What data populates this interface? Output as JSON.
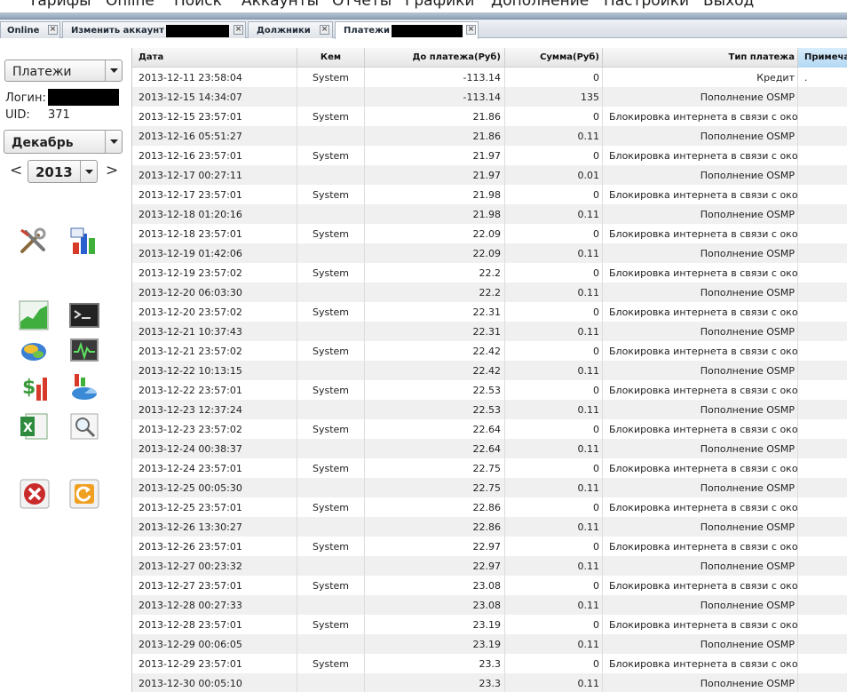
{
  "menu": {
    "items": [
      "Тарифы",
      "Online",
      "Поиск",
      "Аккаунты",
      "Отчеты",
      "Графики",
      "Дополнение",
      "Настройки",
      "Выход"
    ]
  },
  "tabs": [
    {
      "label": "Online",
      "active": false
    },
    {
      "label": "Изменить аккаунт",
      "active": false
    },
    {
      "label": "Должники",
      "active": false
    },
    {
      "label": "Платежи",
      "active": true
    }
  ],
  "left": {
    "report_select": "Платежи",
    "login_label": "Логин:",
    "uid_label": "UID:",
    "uid_value": "371",
    "month_select": "Декабрь",
    "year_select": "2013",
    "prev": "<",
    "next": ">",
    "tools": [
      "tools-icon",
      "bar-chart-icon",
      "line-chart-icon",
      "terminal-icon",
      "network-icon",
      "monitor-icon",
      "money-chart-icon",
      "pie-chart-icon",
      "excel-icon",
      "search-icon"
    ],
    "actions": [
      "close-icon",
      "refresh-icon"
    ]
  },
  "table": {
    "columns": [
      "Дата",
      "Кем",
      "До платежа(Руб)",
      "Сумма(Руб)",
      "Тип платежа",
      "Примеча"
    ],
    "rows": [
      [
        "2013-12-11 23:58:04",
        "System",
        "-113.14",
        "0",
        "Кредит",
        "."
      ],
      [
        "2013-12-15 14:34:07",
        "",
        "-113.14",
        "135",
        "Пополнение OSMP",
        ""
      ],
      [
        "2013-12-15 23:57:01",
        "System",
        "21.86",
        "0",
        "Блокировка интернета в связи с оконча",
        ""
      ],
      [
        "2013-12-16 05:51:27",
        "",
        "21.86",
        "0.11",
        "Пополнение OSMP",
        ""
      ],
      [
        "2013-12-16 23:57:01",
        "System",
        "21.97",
        "0",
        "Блокировка интернета в связи с оконча",
        ""
      ],
      [
        "2013-12-17 00:27:11",
        "",
        "21.97",
        "0.01",
        "Пополнение OSMP",
        ""
      ],
      [
        "2013-12-17 23:57:01",
        "System",
        "21.98",
        "0",
        "Блокировка интернета в связи с оконча",
        ""
      ],
      [
        "2013-12-18 01:20:16",
        "",
        "21.98",
        "0.11",
        "Пополнение OSMP",
        ""
      ],
      [
        "2013-12-18 23:57:01",
        "System",
        "22.09",
        "0",
        "Блокировка интернета в связи с оконча",
        ""
      ],
      [
        "2013-12-19 01:42:06",
        "",
        "22.09",
        "0.11",
        "Пополнение OSMP",
        ""
      ],
      [
        "2013-12-19 23:57:02",
        "System",
        "22.2",
        "0",
        "Блокировка интернета в связи с оконча",
        ""
      ],
      [
        "2013-12-20 06:03:30",
        "",
        "22.2",
        "0.11",
        "Пополнение OSMP",
        ""
      ],
      [
        "2013-12-20 23:57:02",
        "System",
        "22.31",
        "0",
        "Блокировка интернета в связи с оконча",
        ""
      ],
      [
        "2013-12-21 10:37:43",
        "",
        "22.31",
        "0.11",
        "Пополнение OSMP",
        ""
      ],
      [
        "2013-12-21 23:57:02",
        "System",
        "22.42",
        "0",
        "Блокировка интернета в связи с оконча",
        ""
      ],
      [
        "2013-12-22 10:13:15",
        "",
        "22.42",
        "0.11",
        "Пополнение OSMP",
        ""
      ],
      [
        "2013-12-22 23:57:01",
        "System",
        "22.53",
        "0",
        "Блокировка интернета в связи с оконча",
        ""
      ],
      [
        "2013-12-23 12:37:24",
        "",
        "22.53",
        "0.11",
        "Пополнение OSMP",
        ""
      ],
      [
        "2013-12-23 23:57:02",
        "System",
        "22.64",
        "0",
        "Блокировка интернета в связи с оконча",
        ""
      ],
      [
        "2013-12-24 00:38:37",
        "",
        "22.64",
        "0.11",
        "Пополнение OSMP",
        ""
      ],
      [
        "2013-12-24 23:57:01",
        "System",
        "22.75",
        "0",
        "Блокировка интернета в связи с оконча",
        ""
      ],
      [
        "2013-12-25 00:05:30",
        "",
        "22.75",
        "0.11",
        "Пополнение OSMP",
        ""
      ],
      [
        "2013-12-25 23:57:01",
        "System",
        "22.86",
        "0",
        "Блокировка интернета в связи с оконча",
        ""
      ],
      [
        "2013-12-26 13:30:27",
        "",
        "22.86",
        "0.11",
        "Пополнение OSMP",
        ""
      ],
      [
        "2013-12-26 23:57:01",
        "System",
        "22.97",
        "0",
        "Блокировка интернета в связи с оконча",
        ""
      ],
      [
        "2013-12-27 00:23:32",
        "",
        "22.97",
        "0.11",
        "Пополнение OSMP",
        ""
      ],
      [
        "2013-12-27 23:57:01",
        "System",
        "23.08",
        "0",
        "Блокировка интернета в связи с оконча",
        ""
      ],
      [
        "2013-12-28 00:27:33",
        "",
        "23.08",
        "0.11",
        "Пополнение OSMP",
        ""
      ],
      [
        "2013-12-28 23:57:01",
        "System",
        "23.19",
        "0",
        "Блокировка интернета в связи с оконча",
        ""
      ],
      [
        "2013-12-29 00:06:05",
        "",
        "23.19",
        "0.11",
        "Пополнение OSMP",
        ""
      ],
      [
        "2013-12-29 23:57:01",
        "System",
        "23.3",
        "0",
        "Блокировка интернета в связи с оконча",
        ""
      ],
      [
        "2013-12-30 00:05:10",
        "",
        "23.3",
        "0.11",
        "Пополнение OSMP",
        ""
      ]
    ]
  },
  "colors": {
    "menu_stripe": "#8fa3b8",
    "sorted_header": "#b3d8f4",
    "alt_row": "#f0f0f0"
  }
}
